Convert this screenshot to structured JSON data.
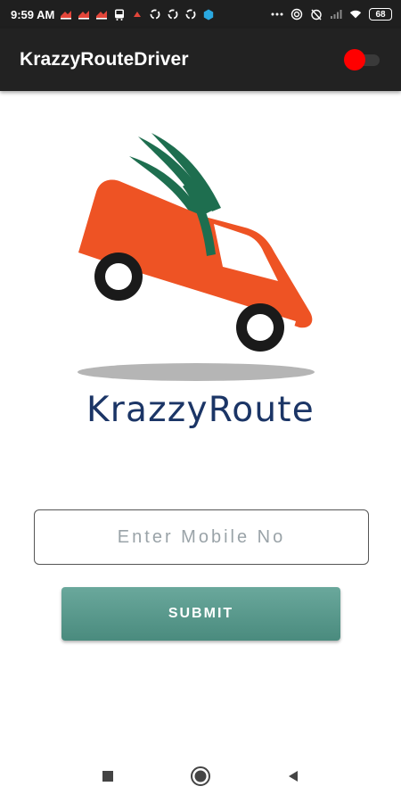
{
  "status_bar": {
    "time": "9:59 AM",
    "battery": "68",
    "icons": [
      "notification-icon",
      "notification-icon",
      "notification-icon",
      "bus-icon",
      "notification-icon",
      "sync-icon",
      "sync-icon",
      "sync-icon",
      "hexagon-app-icon",
      "more-icon",
      "hotspot-icon",
      "alarm-off-icon",
      "signal-icon",
      "wifi-icon",
      "battery-icon"
    ]
  },
  "app_bar": {
    "title": "KrazzyRouteDriver",
    "toggle_color": "#ff0000"
  },
  "logo": {
    "brand_name": "KrazzyRoute",
    "colors": {
      "van": "#ee5324",
      "wing": "#1e6e4f",
      "text": "#1b3566",
      "shadow": "#b5b5b5"
    }
  },
  "form": {
    "mobile_placeholder": "Enter Mobile No",
    "mobile_value": "",
    "submit_label": "SUBMIT",
    "submit_color": "#5a9a8e"
  },
  "nav_bar": {
    "buttons": [
      "recents-square-icon",
      "home-circle-icon",
      "back-triangle-icon"
    ]
  }
}
